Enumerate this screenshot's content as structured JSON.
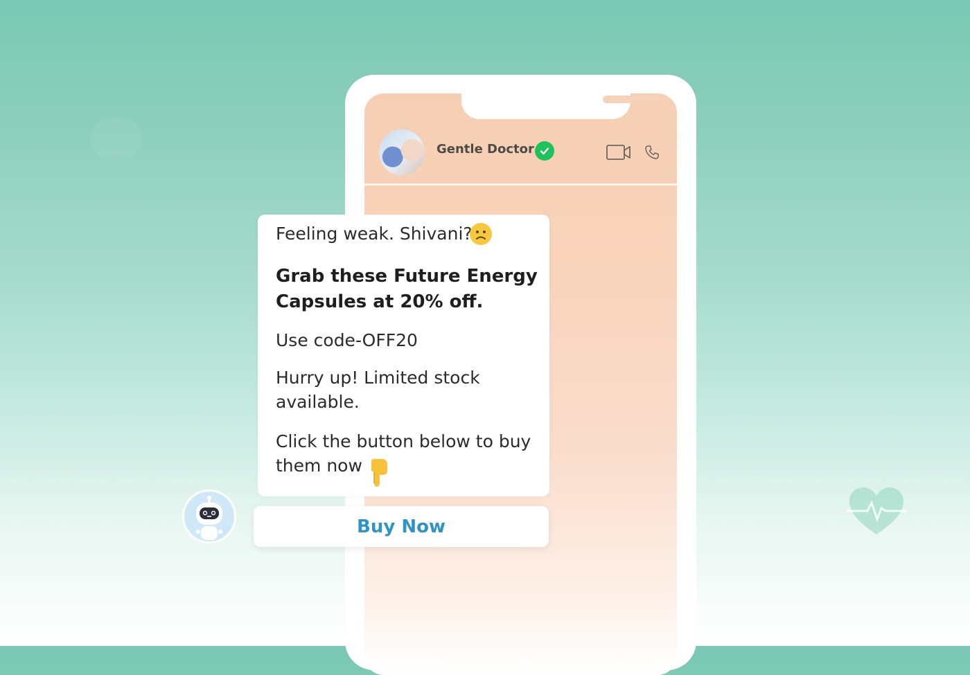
{
  "chat_header": {
    "contact_name": "Gentle Doctor"
  },
  "message": {
    "line1": "Feeling weak. Shivani?",
    "offer_line1": "Grab these Future Energy",
    "offer_line2": "Capsules at 20% off.",
    "code_line": "Use code-OFF20",
    "hurry_line1": "Hurry up! Limited stock",
    "hurry_line2": "available.",
    "click_line1": "Click the button below to buy",
    "click_line2": "them now"
  },
  "cta": {
    "buy_label": "Buy Now"
  },
  "colors": {
    "accent": "#2f93c3",
    "verified": "#1ec15a",
    "background_top": "#79c8b3",
    "screen_tint": "#f6cfb3"
  },
  "icons": [
    "verified-check-icon",
    "video-call-icon",
    "phone-call-icon",
    "sad-face-emoji",
    "point-down-emoji",
    "robot-icon",
    "heartbeat-icon"
  ]
}
